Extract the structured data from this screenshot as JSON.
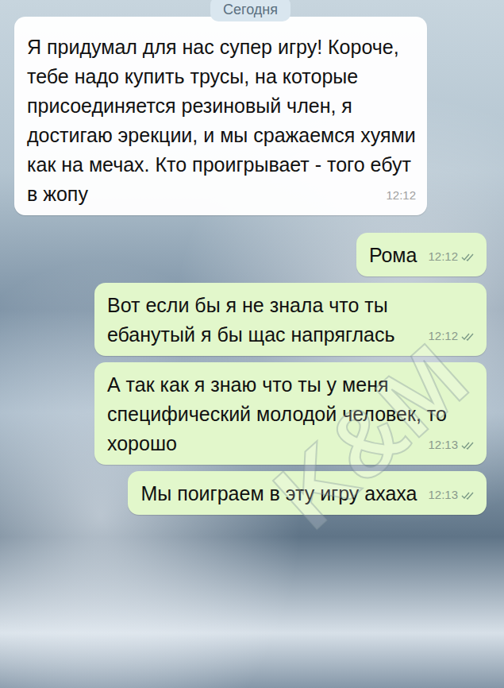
{
  "chat": {
    "date": "Сегодня",
    "watermark": "K&M",
    "messages": [
      {
        "kind": "incoming",
        "text": "Я придумал для нас супер игру! Короче, тебе надо купить трусы, на которые присоединяется резиновый член, я достигаю эрекции, и мы сражаемся хуями как на мечах. Кто проигрывает - того ебут в жопу",
        "time": "12:12",
        "read": false
      },
      {
        "kind": "outgoing",
        "text": "Рома",
        "time": "12:12",
        "read": true
      },
      {
        "kind": "outgoing",
        "text": "Вот если бы я не знала что ты ебанутый я бы щас напряглась",
        "time": "12:12",
        "read": true
      },
      {
        "kind": "outgoing",
        "text": "А так как я знаю что ты у меня специфический молодой человек, то хорошо",
        "time": "12:13",
        "read": true
      },
      {
        "kind": "outgoing",
        "text": "Мы поиграем в эту игру ахаха",
        "time": "12:13",
        "read": true
      }
    ]
  }
}
